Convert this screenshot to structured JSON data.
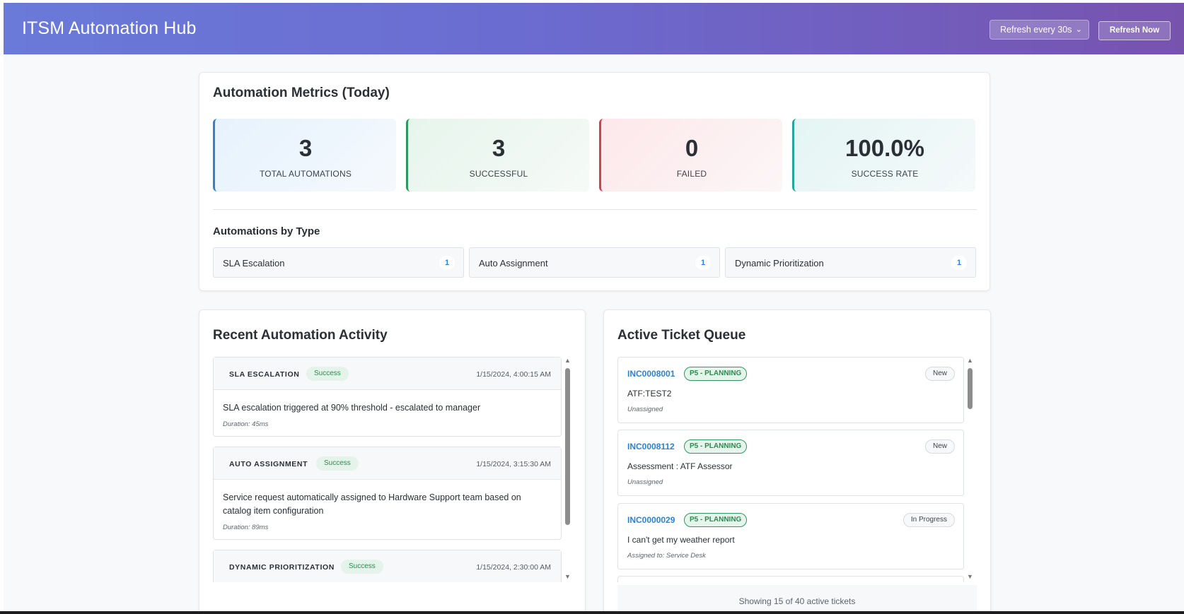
{
  "header": {
    "title": "ITSM Automation Hub",
    "refresh_select_value": "Refresh every 30s",
    "refresh_button_label": "Refresh Now"
  },
  "metrics": {
    "title": "Automation Metrics (Today)",
    "cards": [
      {
        "value": "3",
        "label": "TOTAL AUTOMATIONS",
        "color": "#2c82d6"
      },
      {
        "value": "3",
        "label": "SUCCESSFUL",
        "color": "#2b9a5c"
      },
      {
        "value": "0",
        "label": "FAILED",
        "color": "#d0404f"
      },
      {
        "value": "100.0%",
        "label": "SUCCESS RATE",
        "color": "#26a69a"
      }
    ],
    "by_type_title": "Automations by Type",
    "by_type": [
      {
        "name": "SLA Escalation",
        "count": "1"
      },
      {
        "name": "Auto Assignment",
        "count": "1"
      },
      {
        "name": "Dynamic Prioritization",
        "count": "1"
      }
    ]
  },
  "activity": {
    "title": "Recent Automation Activity",
    "items": [
      {
        "type": "SLA ESCALATION",
        "status": "Success",
        "time": "1/15/2024, 4:00:15 AM",
        "description": "SLA escalation triggered at 90% threshold - escalated to manager",
        "duration": "Duration: 45ms"
      },
      {
        "type": "AUTO ASSIGNMENT",
        "status": "Success",
        "time": "1/15/2024, 3:15:30 AM",
        "description": "Service request automatically assigned to Hardware Support team based on catalog item configuration",
        "duration": "Duration: 89ms"
      },
      {
        "type": "DYNAMIC PRIORITIZATION",
        "status": "Success",
        "time": "1/15/2024, 2:30:00 AM",
        "description": "",
        "duration": ""
      }
    ]
  },
  "queue": {
    "title": "Active Ticket Queue",
    "tickets": [
      {
        "number": "INC0008001",
        "priority": "P5 - PLANNING",
        "state": "New",
        "description": "ATF:TEST2",
        "assignment": "Unassigned"
      },
      {
        "number": "INC0008112",
        "priority": "P5 - PLANNING",
        "state": "New",
        "description": "Assessment : ATF Assessor",
        "assignment": "Unassigned"
      },
      {
        "number": "INC0000029",
        "priority": "P5 - PLANNING",
        "state": "In Progress",
        "description": "I can't get my weather report",
        "assignment": "Assigned to: Service Desk"
      }
    ],
    "footer": "Showing 15 of 40 active tickets"
  },
  "colors": {
    "header_gradient_start": "#6a7ad8",
    "header_gradient_end": "#7753ae",
    "accent_blue": "#2c82d6",
    "success_green": "#2b8a4e"
  }
}
